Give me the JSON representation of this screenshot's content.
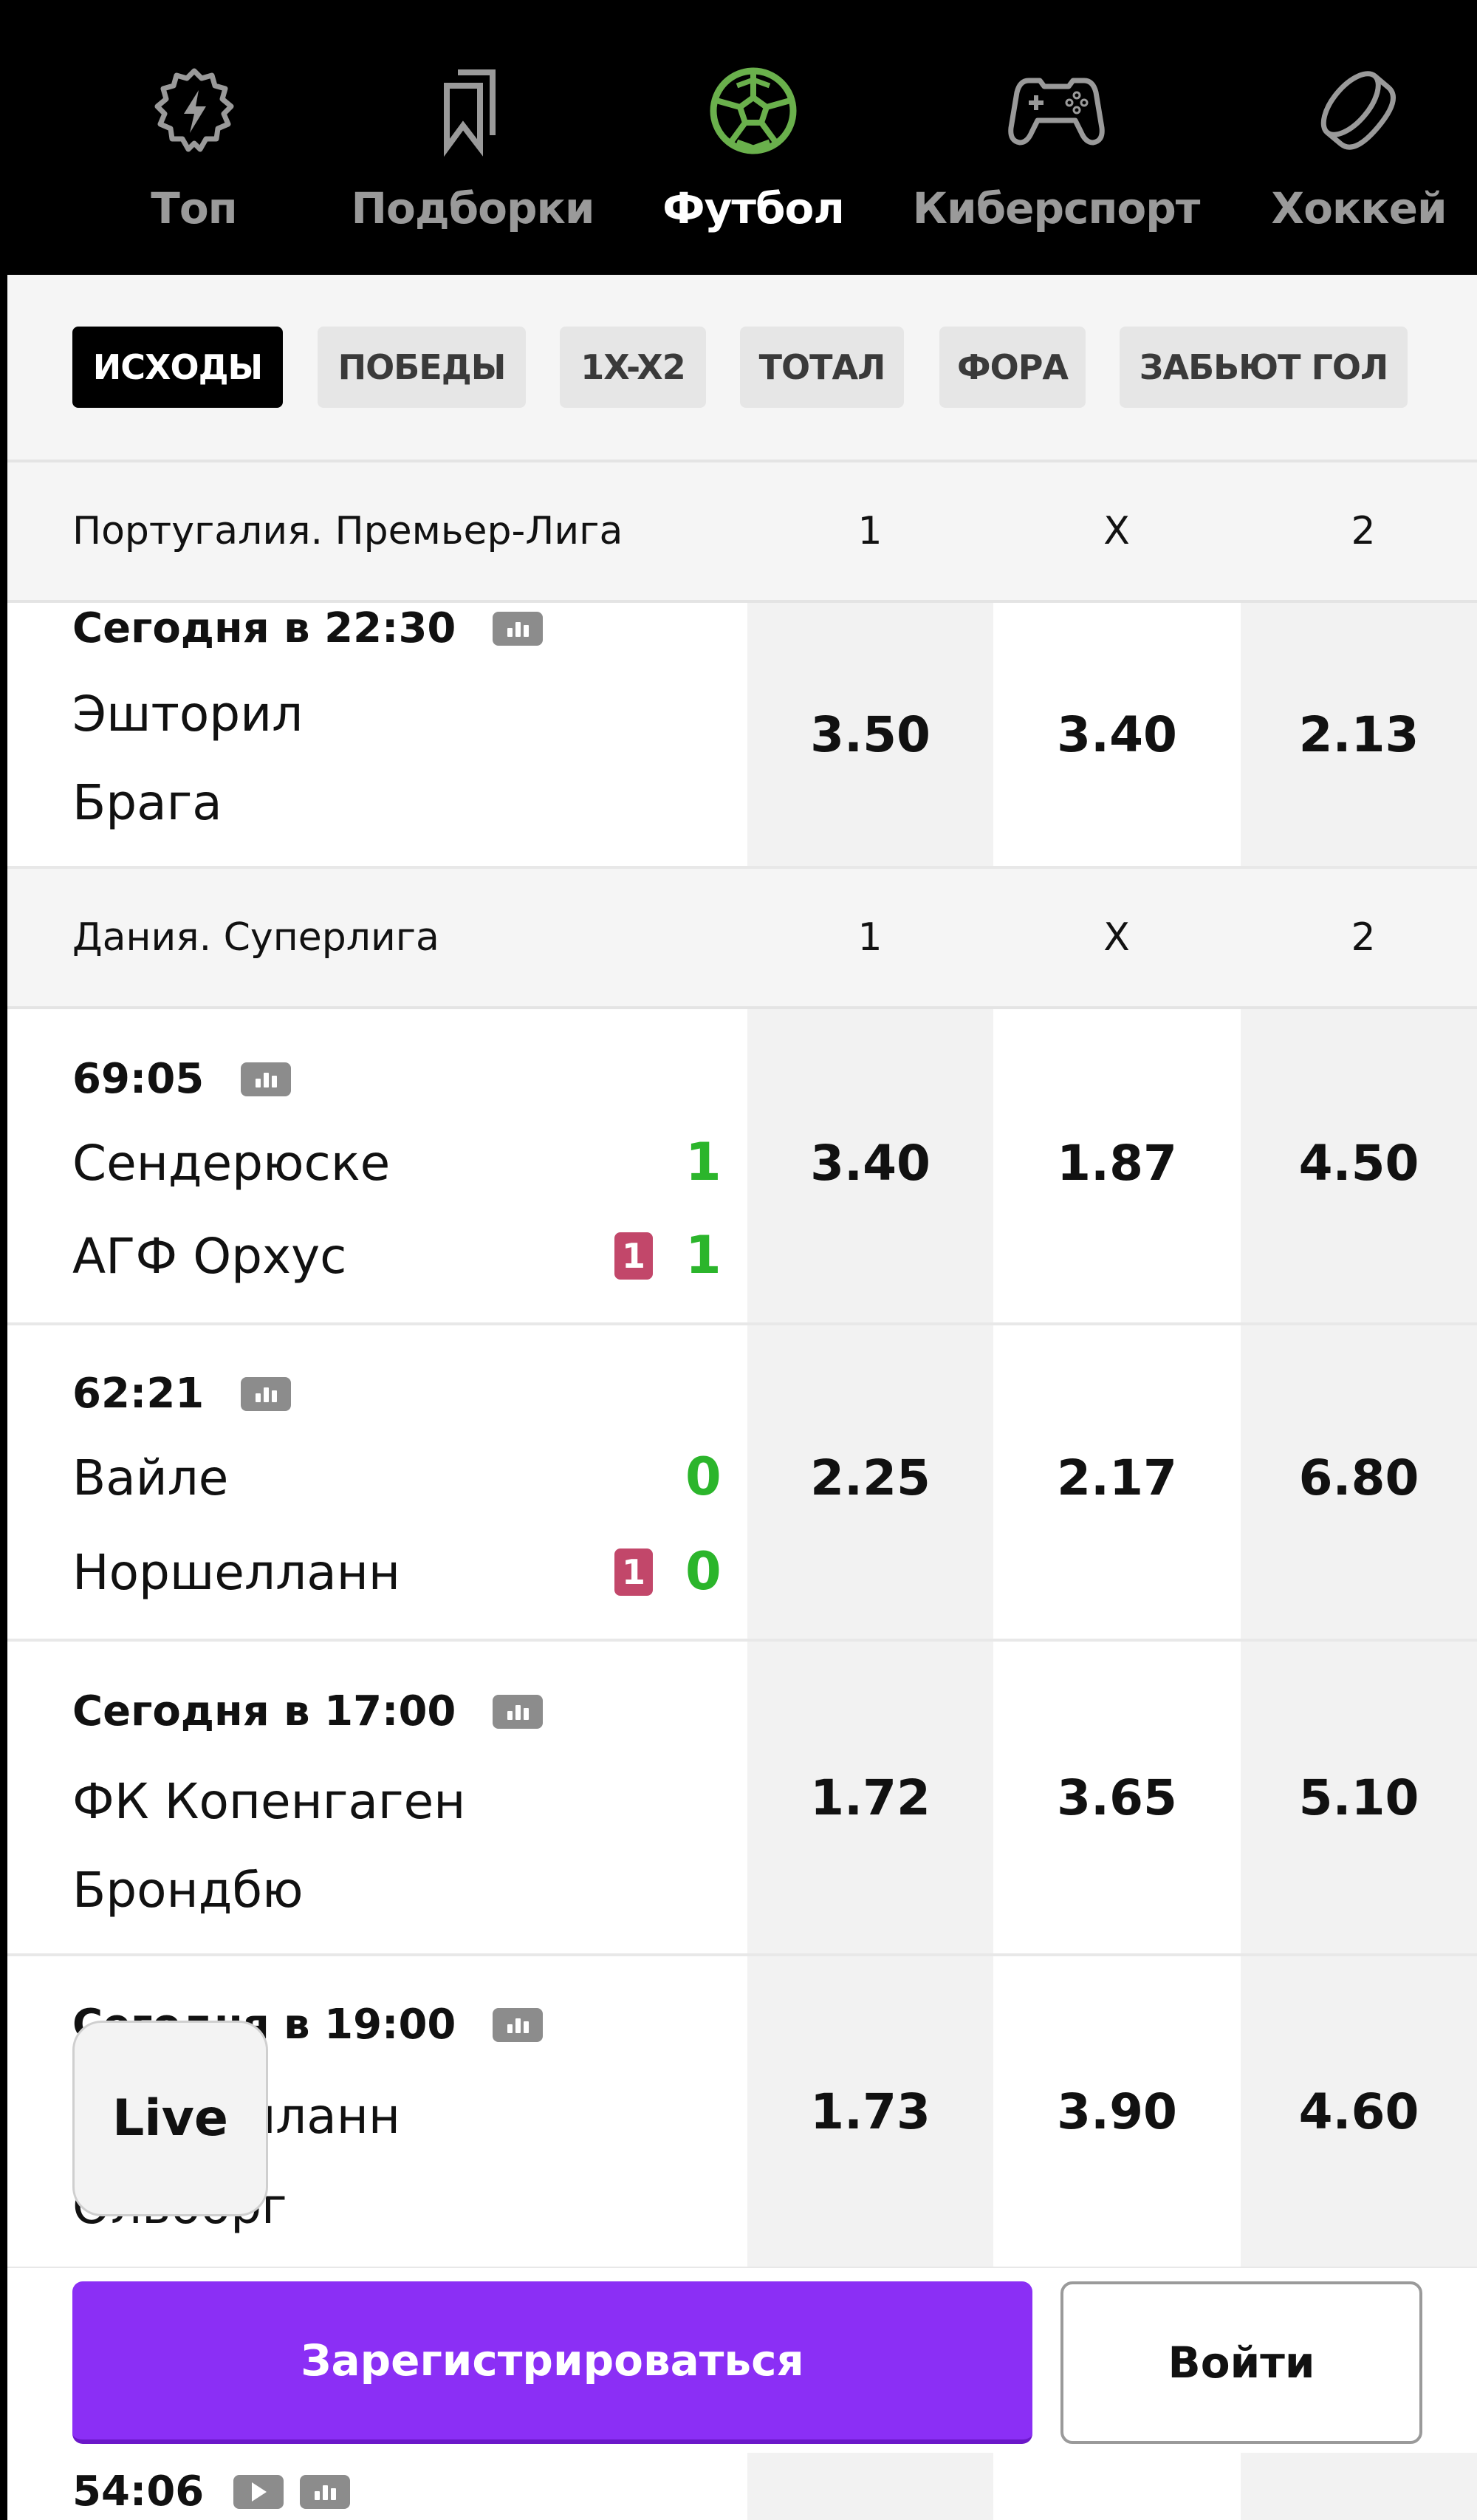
{
  "nav": {
    "items": [
      {
        "label": "Топ",
        "icon": "lightning-badge-icon",
        "active": false
      },
      {
        "label": "Подборки",
        "icon": "bookmarks-icon",
        "active": false
      },
      {
        "label": "Футбол",
        "icon": "soccer-ball-icon",
        "active": true
      },
      {
        "label": "Киберспорт",
        "icon": "gamepad-icon",
        "active": false
      },
      {
        "label": "Хоккей",
        "icon": "hockey-puck-icon",
        "active": false
      }
    ],
    "active_color": "#6ab04c"
  },
  "filters": {
    "chips": [
      {
        "label": "ИСХОДЫ",
        "active": true
      },
      {
        "label": "ПОБЕДЫ",
        "active": false
      },
      {
        "label": "1X-X2",
        "active": false
      },
      {
        "label": "ТОТАЛ",
        "active": false
      },
      {
        "label": "ФОРА",
        "active": false
      },
      {
        "label": "ЗАБЬЮТ ГОЛ",
        "active": false
      }
    ]
  },
  "leagues": [
    {
      "name": "Португалия. Премьер-Лига",
      "columns": [
        "1",
        "X",
        "2"
      ],
      "matches": [
        {
          "time": "Сегодня в 22:30",
          "home": "Эшторил",
          "away": "Брага",
          "odds": [
            "3.50",
            "3.40",
            "2.13"
          ]
        }
      ]
    },
    {
      "name": "Дания. Суперлига",
      "columns": [
        "1",
        "X",
        "2"
      ],
      "matches": [
        {
          "time": "69:05",
          "home": "Сендерюске",
          "away": "АГФ Орхус",
          "home_score": "1",
          "away_score": "1",
          "away_red_cards": "1",
          "odds": [
            "3.40",
            "1.87",
            "4.50"
          ]
        },
        {
          "time": "62:21",
          "home": "Вайле",
          "away": "Норшелланн",
          "home_score": "0",
          "away_score": "0",
          "away_red_cards": "1",
          "odds": [
            "2.25",
            "2.17",
            "6.80"
          ]
        },
        {
          "time": "Сегодня в 17:00",
          "home": "ФК Копенгаген",
          "away": "Брондбю",
          "odds": [
            "1.72",
            "3.65",
            "5.10"
          ]
        },
        {
          "time": "Сегодня в 19:00",
          "home": "Норшелланн",
          "away": "Ольборг",
          "odds": [
            "1.73",
            "3.90",
            "4.60"
          ]
        },
        {
          "time": "54:06"
        }
      ]
    }
  ],
  "live_button": {
    "label": "Live"
  },
  "auth": {
    "register_label": "Зарегистрироваться",
    "login_label": "Войти",
    "register_color": "#8b2ff5"
  },
  "colors": {
    "score": "#2bb52b",
    "red_card": "#c2476a"
  }
}
